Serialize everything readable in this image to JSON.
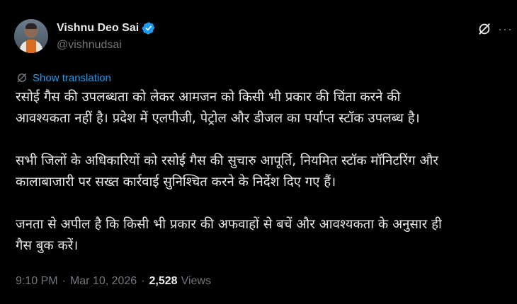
{
  "author": {
    "display_name": "Vishnu Deo Sai",
    "handle": "@vishnudsai",
    "verified": true
  },
  "actions": {
    "grok_icon": "grok-icon",
    "more_icon": "more-icon",
    "more_glyph": "···"
  },
  "translation": {
    "label": "Show translation",
    "icon": "translate-icon"
  },
  "tweet": {
    "text": "रसोई गैस की उपलब्धता को लेकर आमजन को किसी भी प्रकार की चिंता करने की\nआवश्यकता नहीं है। प्रदेश में एलपीजी, पेट्रोल और डीजल का पर्याप्त स्टॉक उपलब्ध है।\n\nसभी जिलों के अधिकारियों को रसोई गैस की सुचारु आपूर्ति, नियमित स्टॉक मॉनिटरिंग और\nकालाबाजारी पर सख्त कार्रवाई सुनिश्चित करने के निर्देश दिए गए हैं।\n\nजनता से अपील है कि किसी भी प्रकार की अफवाहों से बचें और आवश्यकता के अनुसार ही\nगैस बुक करें।"
  },
  "meta": {
    "time": "9:10 PM",
    "date": "Mar 10, 2026",
    "separator": "·",
    "views_count": "2,528",
    "views_label": "Views"
  },
  "colors": {
    "background": "#000000",
    "text": "#e7e9ea",
    "secondary": "#71767b",
    "accent": "#1d9bf0"
  }
}
